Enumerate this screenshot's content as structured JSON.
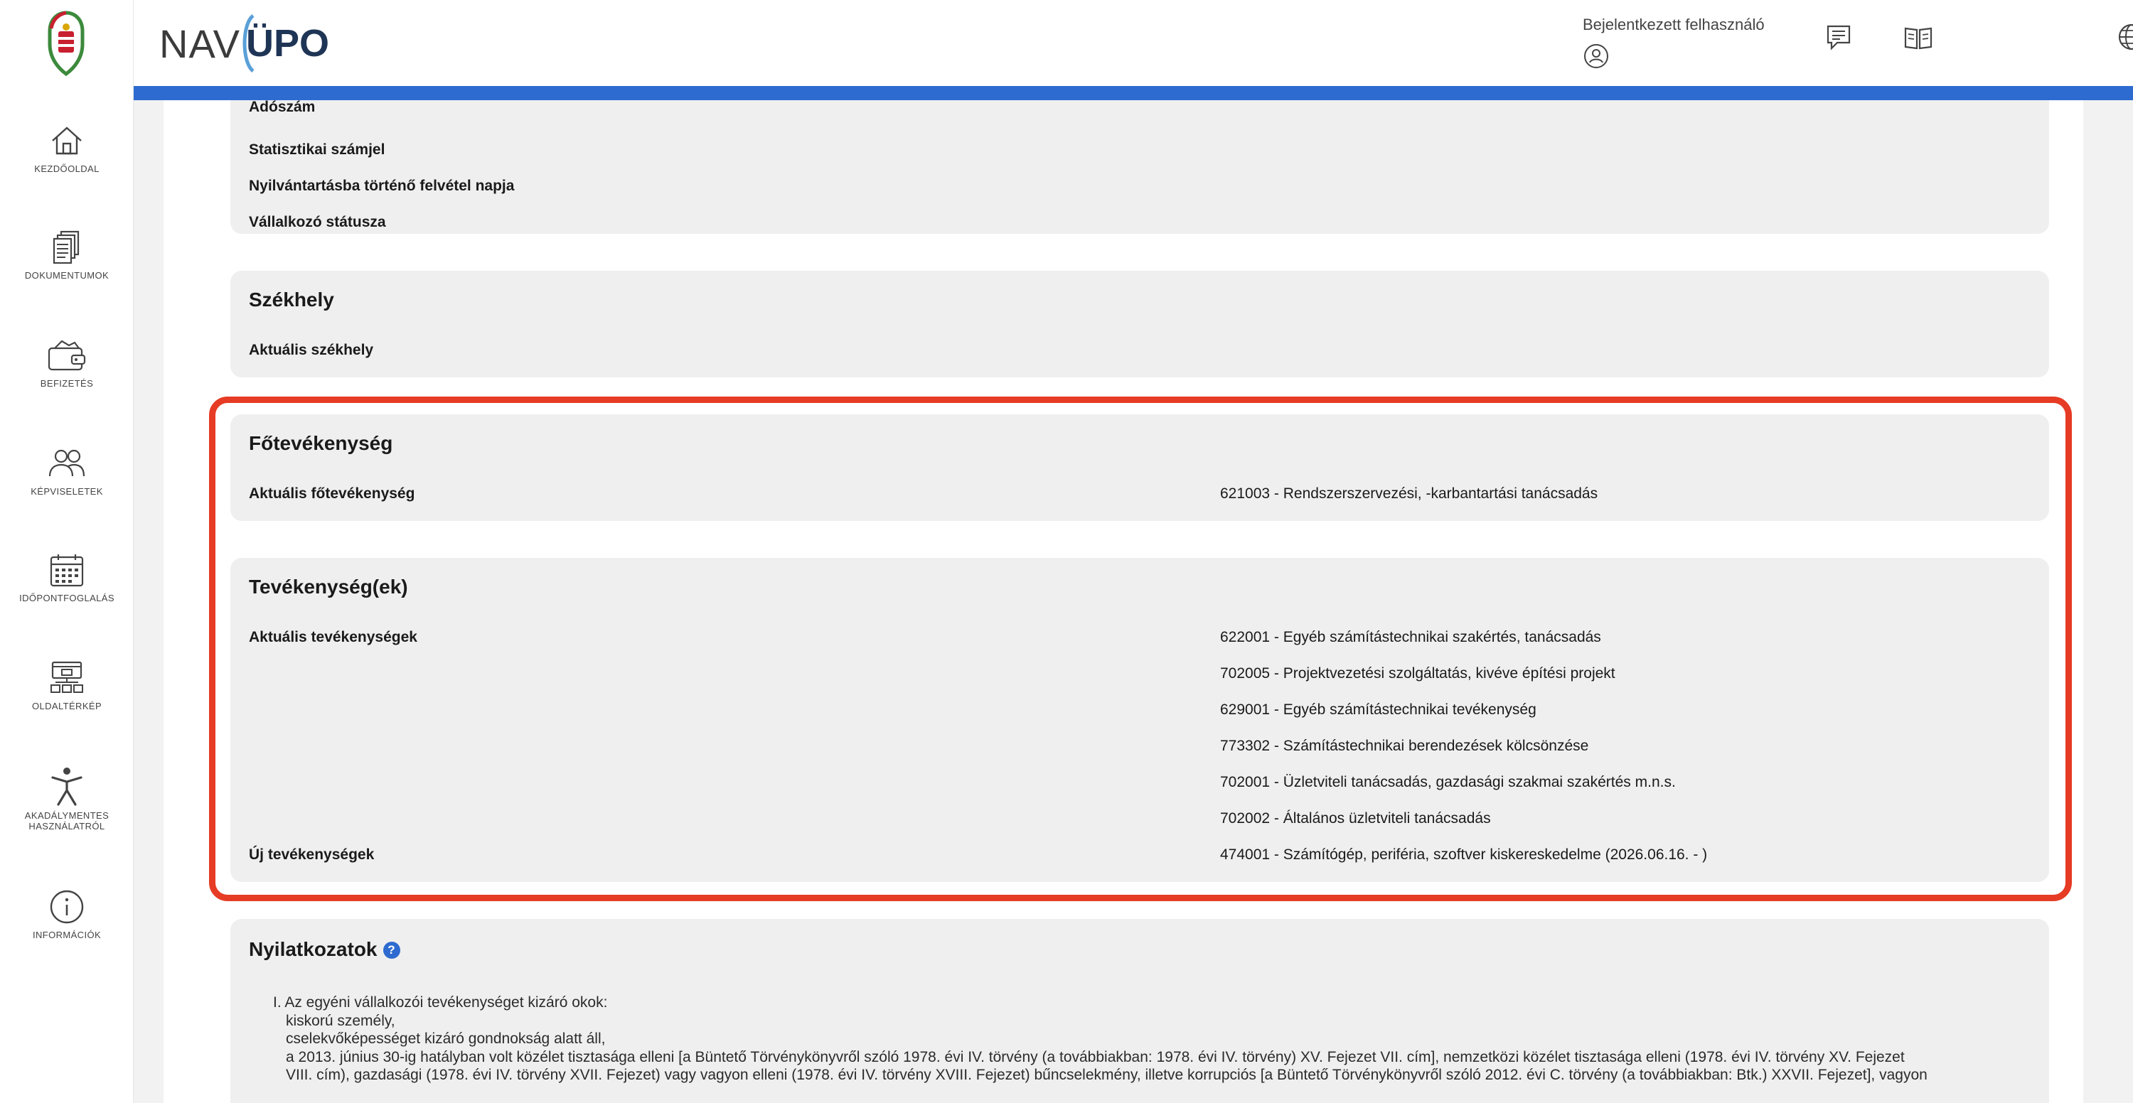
{
  "header": {
    "logo_prefix": "NAV",
    "logo_suffix": "ÜPO",
    "user_label": "Bejelentkezett felhasználó"
  },
  "sidebar": {
    "items": [
      {
        "label": "KEZDŐOLDAL",
        "icon": "home-icon"
      },
      {
        "label": "DOKUMENTUMOK",
        "icon": "documents-icon"
      },
      {
        "label": "BEFIZETÉS",
        "icon": "wallet-icon"
      },
      {
        "label": "KÉPVISELETEK",
        "icon": "people-icon"
      },
      {
        "label": "IDŐPONTFOGLALÁS",
        "icon": "calendar-icon"
      },
      {
        "label": "OLDALTÉRKÉP",
        "icon": "sitemap-icon"
      },
      {
        "label": "AKADÁLYMENTES",
        "label2": "HASZNÁLATRÓL",
        "icon": "accessibility-icon"
      },
      {
        "label": "INFORMÁCIÓK",
        "icon": "info-icon"
      }
    ]
  },
  "personal_card": {
    "partial_label": "Adószám",
    "rows": [
      "Statisztikai számjel",
      "Nyilvántartásba történő felvétel napja",
      "Vállalkozó státusza"
    ]
  },
  "szekhely": {
    "title": "Székhely",
    "row_label": "Aktuális székhely"
  },
  "fotevekenyseg": {
    "title": "Főtevékenység",
    "row_label": "Aktuális főtevékenység",
    "row_value": "621003 - Rendszerszervezési, -karbantartási tanácsadás"
  },
  "tevekenysegek": {
    "title": "Tevékenység(ek)",
    "current_label": "Aktuális tevékenységek",
    "current": [
      "622001 - Egyéb számítástechnikai szakértés, tanácsadás",
      "702005 - Projektvezetési szolgáltatás, kivéve építési projekt",
      "629001 - Egyéb számítástechnikai tevékenység",
      "773302 - Számítástechnikai berendezések kölcsönzése",
      "702001 - Üzletviteli tanácsadás, gazdasági szakmai szakértés m.n.s.",
      "702002 - Általános üzletviteli tanácsadás"
    ],
    "new_label": "Új tevékenységek",
    "new_value": "474001 - Számítógép, periféria, szoftver kiskereskedelme (2026.06.16. - )"
  },
  "nyilatkozatok": {
    "title": "Nyilatkozatok",
    "help": "?",
    "lines": [
      "I. Az egyéni vállalkozói tevékenységet kizáró okok:",
      "kiskorú személy,",
      "cselekvőképességet kizáró gondnokság alatt áll,",
      "a 2013. június 30-ig hatályban volt közélet tisztasága elleni [a Büntető Törvénykönyvről szóló 1978. évi IV. törvény (a továbbiakban: 1978. évi IV. törvény) XV. Fejezet VII. cím], nemzetközi közélet tisztasága elleni (1978. évi IV. törvény XV. Fejezet",
      "VIII. cím), gazdasági (1978. évi IV. törvény XVII. Fejezet) vagy vagyon elleni (1978. évi IV. törvény XVIII. Fejezet) bűncselekmény, illetve korrupciós [a Büntető Törvénykönyvről szóló 2012. évi C. törvény (a továbbiakban: Btk.) XXVII. Fejezet], vagyon"
    ]
  },
  "colors": {
    "accent": "#2e6bd0",
    "highlight": "#e63b24",
    "card_bg": "#efefef",
    "page_bg": "#f2f2f2"
  }
}
